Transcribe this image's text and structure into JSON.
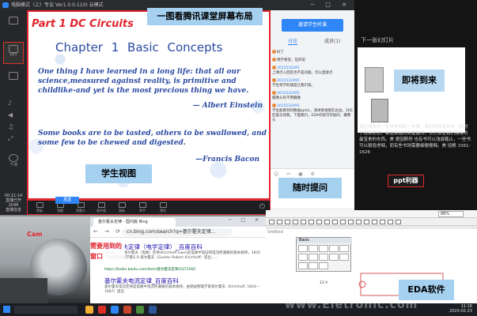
{
  "tc": {
    "title": "电脑模式（上）专议 Ver1.0.0.110) 云模式",
    "sidebar": {
      "ppt": "PPT",
      "down": "下课",
      "time": "00:11:14",
      "live": "直播已开",
      "fps": "2048",
      "status": "直播信息"
    },
    "toolbar": [
      "黑板",
      "答题",
      "答题卡",
      "画中画",
      "画板",
      "举手",
      "预览"
    ]
  },
  "slide": {
    "title": "Part 1 DC Circuits",
    "heading": "Chapter 1    Basic  Concepts",
    "quote1": "One thing I have learned in a long life: that all our science,measured against reality, is primitive and childlike-and yet is the most precious thing we have.",
    "author1": "— Albert Einstein",
    "quote2": "Some books are to be tasted, others to be swallowed, and some few to be chewed and digested.",
    "author2": "—Francis Bacon"
  },
  "annotations": {
    "screen_layout": "一图看腾讯课堂屏幕布局",
    "student_view": "学生视图",
    "ask": "随时提问",
    "coming": "即将到来",
    "ppt_tool": "ppt利器",
    "needed_window": "需要用到的窗口",
    "eda": "EDA软件",
    "cam": "Cam"
  },
  "chat": {
    "invite": "邀请学生听课",
    "tab_discuss": "讨论",
    "tab_members": "成员(1)",
    "messages": [
      {
        "id": "",
        "text": "好了"
      },
      {
        "id": "",
        "text": "预学者签，但开说"
      },
      {
        "id": "3015532495",
        "text": "上课点入回签也不是问题。可以直接点"
      },
      {
        "id": "3015532495",
        "text": "学生架学的速度让我们现。"
      },
      {
        "id": "3015532495",
        "text": "摄像头有不用摄像"
      },
      {
        "id": "3015532495",
        "text": "学生能看到的数据ppt么，演讲者视图在右边，讨论区能与快我，下面我们，EDA作就可可拍的，摄像头"
      }
    ],
    "send": "发送"
  },
  "presenter": {
    "next_label": "下一张幻灯片",
    "notes": "我在漫长的一生中学到的一件事：我们的所有科学（相对于现实而言）都是原始的和重置的，但它却是我们拥有的最宝贵的东西。美 爱因斯坦 也有书可以浅尝辄止，一些书可以狼吞虎咽，而有些书则需要细嚼慢咽。美 培根 1561-1626"
  },
  "browser": {
    "tab": "基尔霍夫定律 - 国内版 Bing",
    "url": "cn.bing.com/search?q=基尔霍夫定律...",
    "r1_title": "基尔霍夫定律（电学定律）_百度百科",
    "r1_desc": "2018-7-3 · 基尔霍夫（电路）定律(Kirchhoff laws)是电路中电压和电流所遵循的基本规律，1845年由德国物理学家G.R.基尔霍夫（Gustav Robert Kirchhoff）提出……",
    "r1_url": "https://baike.baidu.com/item/基尔霍夫定律/2371560",
    "r2_title": "基尔霍夫电流定律_百度百科",
    "r2_desc": "基尔霍夫电流定律是电路中电流所遵循的基本规律，由德国物理学家基尔霍夫（Kirchhoff, 1824—1887）提出"
  },
  "eda": {
    "zoom": "88%",
    "doc": "Untitled",
    "basic": "Basic",
    "volt": "12 V"
  },
  "clock": {
    "time": "11:16",
    "date": "2020-02-23"
  },
  "watermark": "www.Eletronic.com"
}
